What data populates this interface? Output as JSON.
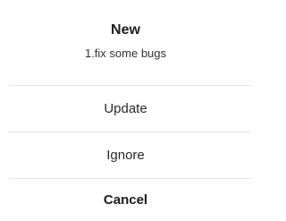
{
  "dialog": {
    "title": "New",
    "message": "1.fix some bugs",
    "actions": {
      "update": "Update",
      "ignore": "Ignore",
      "cancel": "Cancel"
    }
  }
}
